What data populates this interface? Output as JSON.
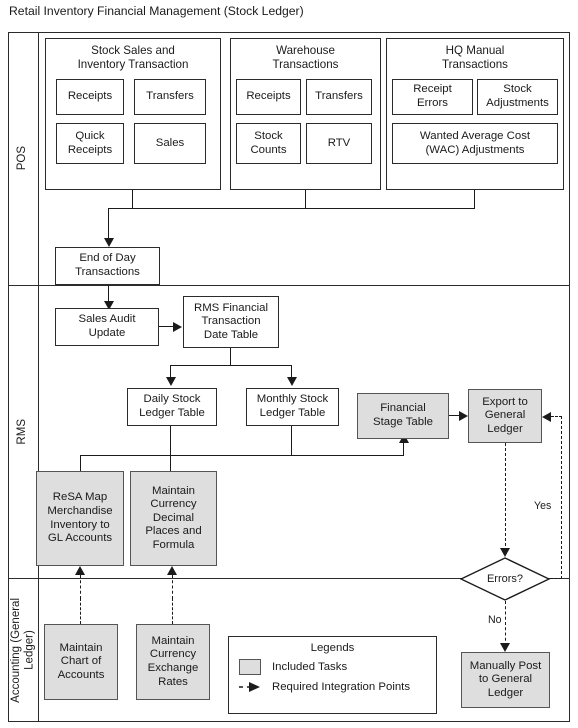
{
  "title": "Retail Inventory Financial Management (Stock Ledger)",
  "lanes": [
    {
      "id": "pos",
      "label": "POS"
    },
    {
      "id": "rms",
      "label": "RMS"
    },
    {
      "id": "accounting",
      "label": "Accounting (General\nLedger)"
    }
  ],
  "pos": {
    "groups": [
      {
        "id": "stock-sales",
        "title": "Stock Sales and\nInventory Transaction",
        "tasks": [
          "Receipts",
          "Transfers",
          "Quick\nReceipts",
          "Sales"
        ]
      },
      {
        "id": "warehouse",
        "title": "Warehouse\nTransactions",
        "tasks": [
          "Receipts",
          "Transfers",
          "Stock\nCounts",
          "RTV"
        ]
      },
      {
        "id": "hq-manual",
        "title": "HQ Manual\nTransactions",
        "tasks": [
          "Receipt\nErrors",
          "Stock\nAdjustments",
          "Wanted Average Cost\n(WAC) Adjustments"
        ]
      }
    ],
    "end_of_day": "End of Day\nTransactions"
  },
  "rms": {
    "sales_audit_update": "Sales Audit\nUpdate",
    "financial_transaction_date_table": "RMS Financial\nTransaction\nDate Table",
    "daily_stock_ledger_table": "Daily Stock\nLedger Table",
    "monthly_stock_ledger_table": "Monthly Stock\nLedger Table",
    "financial_stage_table": "Financial\nStage Table",
    "export_to_general_ledger": "Export to\nGeneral\nLedger",
    "resa_map": "ReSA Map\nMerchandise\nInventory  to\nGL Accounts",
    "maintain_currency_decimal": "Maintain\nCurrency\nDecimal\nPlaces and\nFormula",
    "errors_decision": "Errors?",
    "errors_yes": "Yes",
    "errors_no": "No"
  },
  "accounting": {
    "maintain_chart_of_accounts": "Maintain\nChart of\nAccounts",
    "maintain_currency_exchange_rates": "Maintain\nCurrency\nExchange\nRates",
    "manually_post": "Manually Post\nto General\nLedger"
  },
  "legend": {
    "title": "Legends",
    "included_tasks": "Included Tasks",
    "required_integration_points": "Required Integration Points"
  },
  "colors": {
    "shaded_fill": "#dedede",
    "shaded_border": "#555555",
    "line": "#1b1b1b",
    "frame": "#2b2b2b"
  }
}
